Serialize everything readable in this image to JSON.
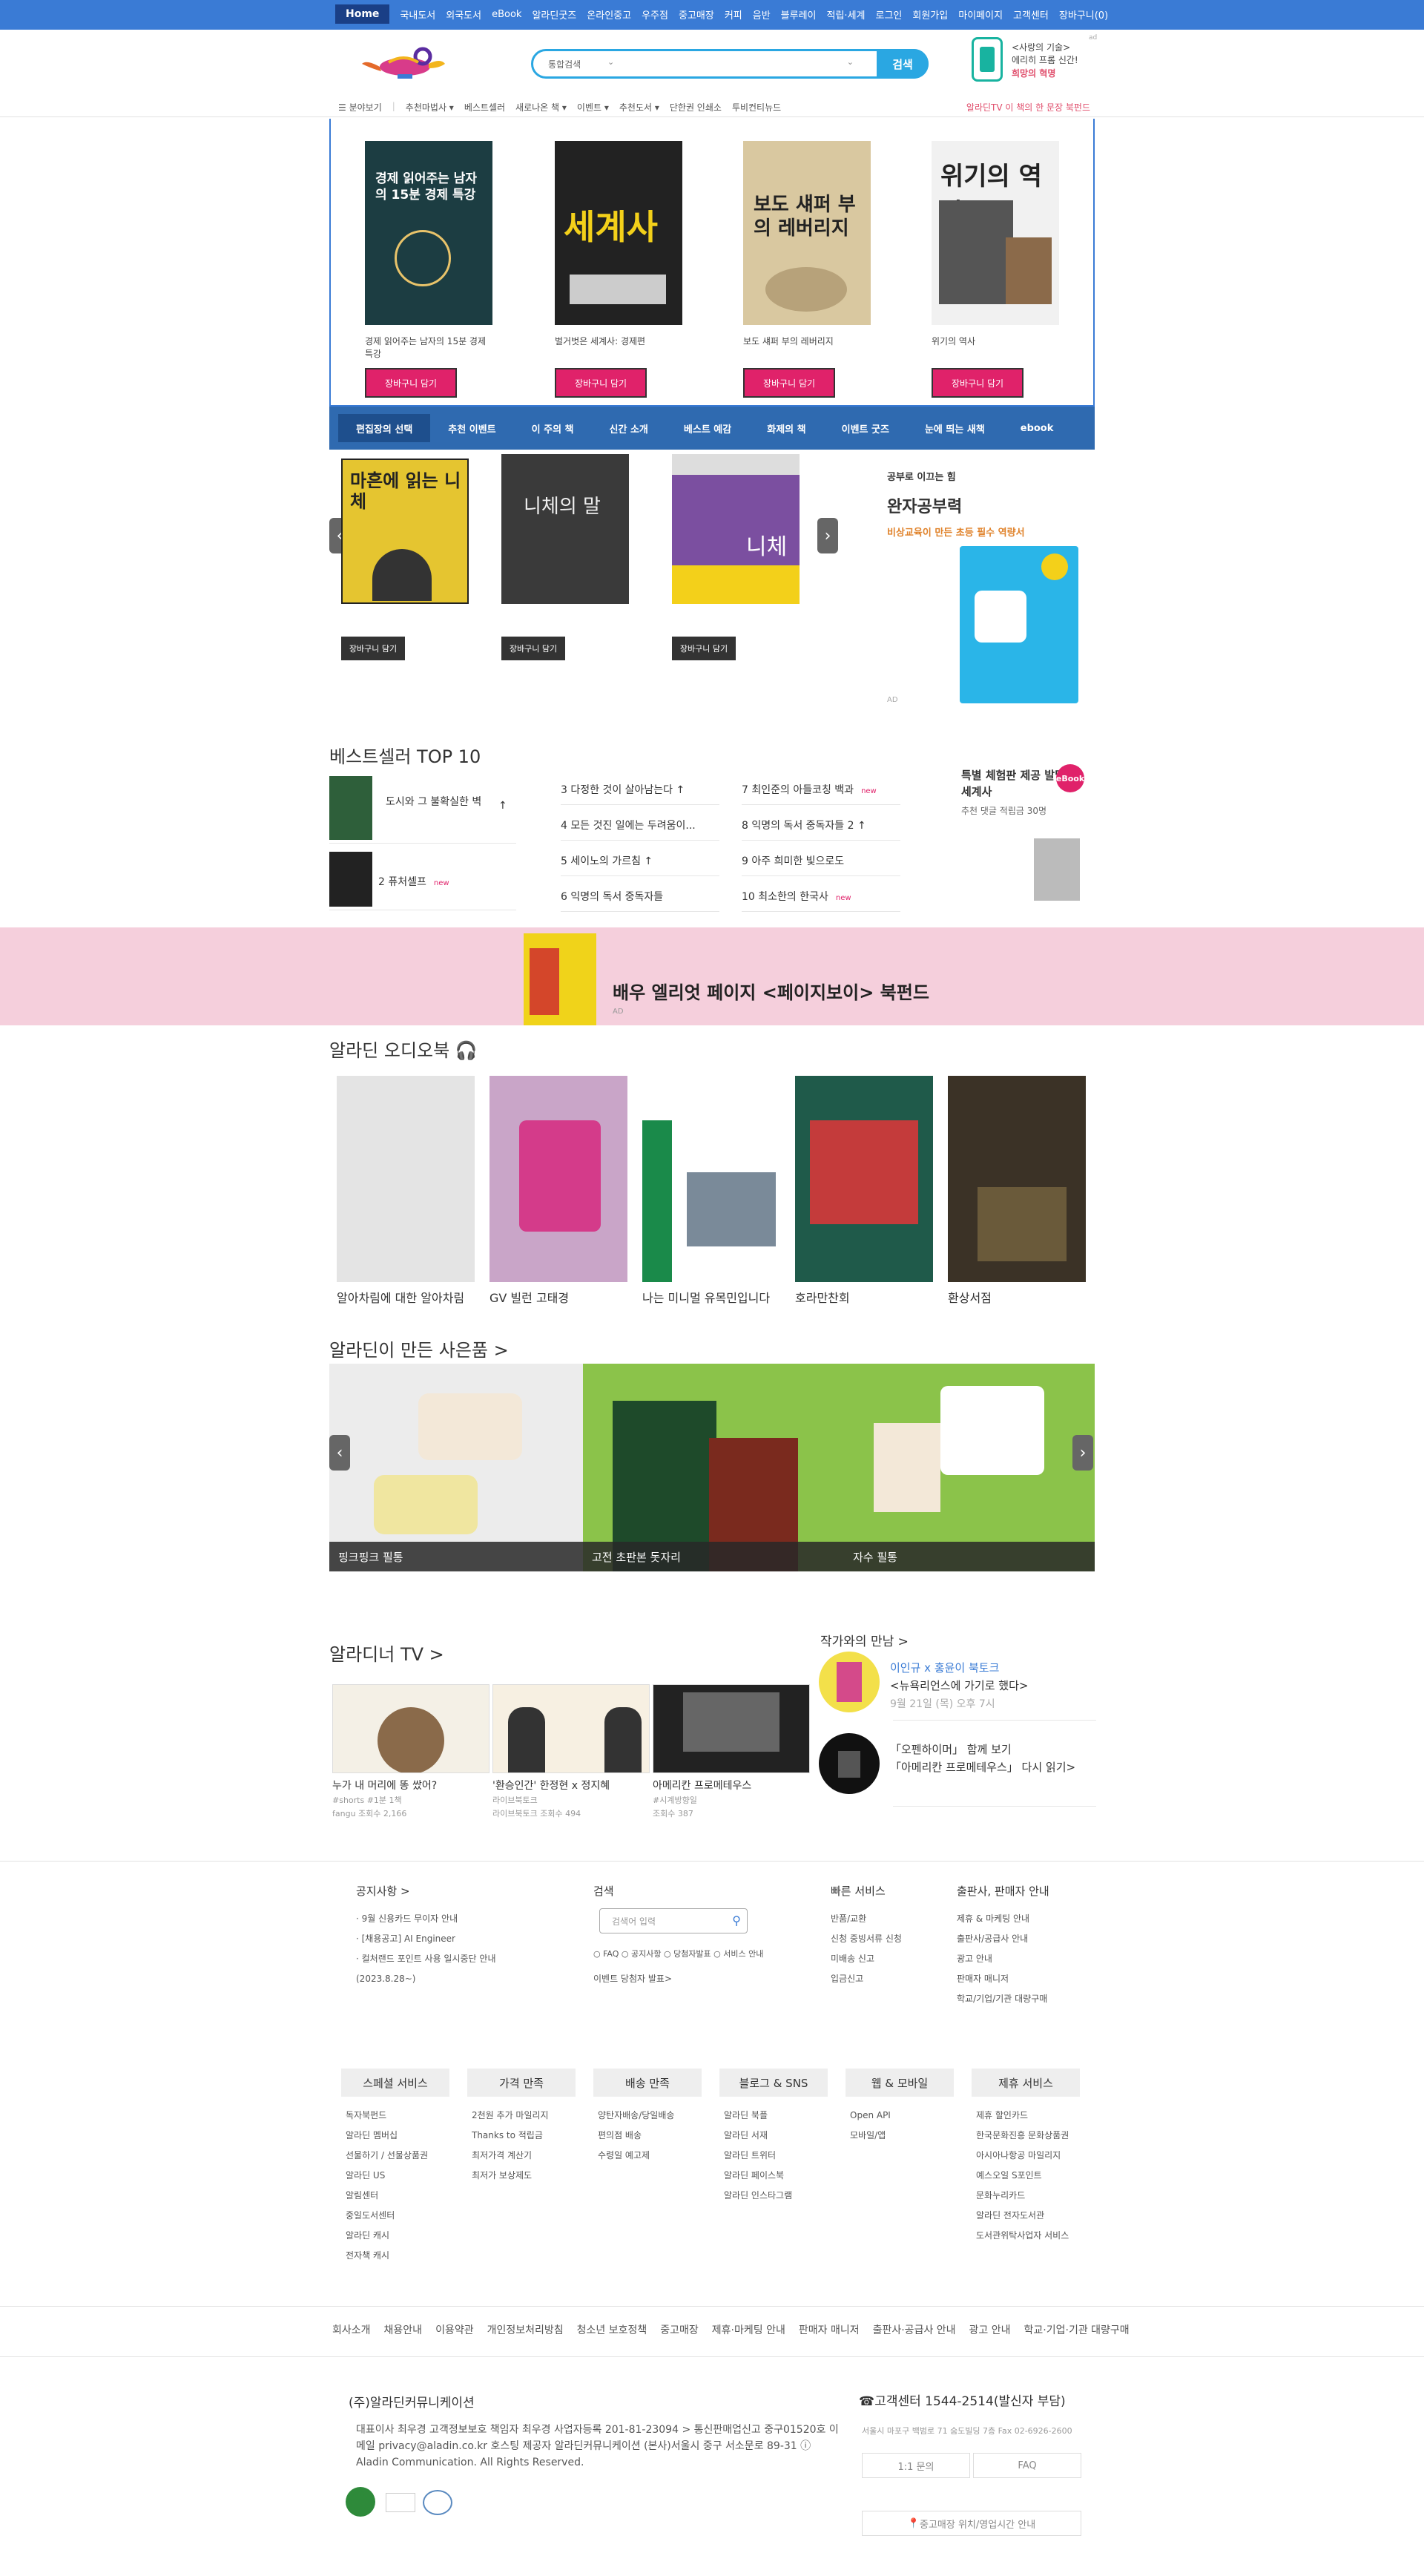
{
  "topnav": {
    "home": "Home",
    "items": [
      "국내도서",
      "외국도서",
      "eBook",
      "알라딘굿즈",
      "온라인중고",
      "우주점",
      "중고매장",
      "커피",
      "음반",
      "블루레이",
      "적립·세계",
      "로그인",
      "회원가입",
      "마이페이지",
      "고객센터",
      "장바구니(0)"
    ]
  },
  "search": {
    "category": "통합검색",
    "button": "검색"
  },
  "header_ad": {
    "line1": "<사랑의 기술>",
    "line2": "에리히 프롬 신간!",
    "line3": "희망의 혁명",
    "ad": "ad"
  },
  "subnav": {
    "items": [
      "분야보기",
      "추천마법사 ▾",
      "베스트셀러",
      "새로나온 책 ▾",
      "이벤트 ▾",
      "추천도서 ▾",
      "단한권 인쇄소",
      "투비컨티뉴드"
    ],
    "right": "알라딘TV 이 책의 한 문장 북펀드"
  },
  "featured": [
    {
      "title": "경제 읽어주는 남자의 15분 경제 특강",
      "cover_text": "경제 읽어주는 남자의 15분 경제 특강",
      "cart": "장바구니 담기"
    },
    {
      "title": "벌거벗은 세계사: 경제편",
      "cover_text": "세계사",
      "cart": "장바구니 담기"
    },
    {
      "title": "보도 섀퍼 부의 레버리지",
      "cover_text": "보도 섀퍼 부의 레버리지",
      "cart": "장바구니 담기"
    },
    {
      "title": "위기의 역사",
      "cover_text": "위기의 역사",
      "cart": "장바구니 담기"
    }
  ],
  "tabs": [
    "편집장의 선택",
    "추천 이벤트",
    "이 주의 책",
    "신간 소개",
    "베스트 예감",
    "화제의 책",
    "이벤트 굿즈",
    "눈에 띄는 새책",
    "ebook"
  ],
  "carousel": [
    {
      "cover_text": "마흔에 읽는 니체",
      "cart": "장바구니 담기"
    },
    {
      "cover_text": "니체의 말",
      "cart": "장바구니 담기"
    },
    {
      "cover_text": "니체",
      "cart": "장바구니 담기"
    }
  ],
  "promo": {
    "small": "공부로 이끄는 힘",
    "big": "완자공부력",
    "sub": "비상교육이 만든 초등 필수 역량서",
    "ad": "AD"
  },
  "bestseller": {
    "title": "베스트셀러 TOP 10",
    "items": [
      {
        "text": "도시와 그 불확실한 벽",
        "arrow": "↑",
        "new": ""
      },
      {
        "text": "2 퓨처셀프",
        "arrow": "",
        "new": "new"
      },
      {
        "text": "3 다정한 것이 살아남는다",
        "arrow": "↑",
        "new": ""
      },
      {
        "text": "4 모든 것진 일에는 두려움이...",
        "arrow": "",
        "new": ""
      },
      {
        "text": "5 세이노의 가르침",
        "arrow": "↑",
        "new": ""
      },
      {
        "text": "6 익명의 독서 중독자들",
        "arrow": "",
        "new": ""
      },
      {
        "text": "7 최인준의 아들코칭 백과",
        "arrow": "",
        "new": "new"
      },
      {
        "text": "8 익명의 독서 중독자들 2",
        "arrow": "↑",
        "new": ""
      },
      {
        "text": "9 아주 희미한 빛으로도",
        "arrow": "",
        "new": ""
      },
      {
        "text": "10 최소한의 한국사",
        "arrow": "",
        "new": "new"
      }
    ],
    "ebook_title": "특별 체험판 제공 발밑의 세계사",
    "ebook_sub": "추천 댓글 적립금 30명",
    "ebook_badge": "eBook"
  },
  "pink_banner": {
    "text": "배우 엘리엇 페이지 <페이지보이> 북펀드",
    "ad": "AD"
  },
  "audiobook": {
    "title": "알라딘 오디오북",
    "items": [
      "알아차림에 대한 알아차림",
      "GV 빌런 고태경",
      "나는 미니멀 유목민입니다",
      "호라만찬회",
      "환상서점"
    ]
  },
  "goods": {
    "title": "알라딘이 만든 사은품 >",
    "items": [
      "핑크핑크 필통",
      "고전 초판본 돗자리",
      "자수 필통"
    ]
  },
  "tv": {
    "title": "알라디너 TV >",
    "items": [
      {
        "title": "누가 내 머리에 똥 쌌어?",
        "meta1": "#shorts #1분 1책",
        "meta2": "fangu 조회수 2,166"
      },
      {
        "title": "'환승인간' 한정현 x 정지혜",
        "meta1": "라이브북토크",
        "meta2": "라이브북토크 조회수 494"
      },
      {
        "title": "아메리칸 프로메테우스",
        "meta1": "#시계방향일",
        "meta2": "조회수 387"
      }
    ]
  },
  "author": {
    "title": "작가와의 만남 >",
    "items": [
      {
        "line1": "이인규 x 홍윤이 북토크",
        "line2": "<뉴욕리언스에 가기로 했다>",
        "date": "9월 21일 (목) 오후 7시"
      },
      {
        "line1": "「오펜하이머」 함께 보기",
        "line2": "「아메리칸 프로메테우스」 다시 읽기>",
        "date": ""
      }
    ]
  },
  "footer": {
    "notice_title": "공지사항 >",
    "notices": [
      "· 9월 신용카드 무이자 안내",
      "· [채용공고] AI Engineer",
      "· 컬처랜드 포인트 사용 일시중단 안내(2023.8.28~)"
    ],
    "search_title": "검색",
    "search_placeholder": "검색어 입력",
    "search_options": "○ FAQ ○ 공지사항 ○ 당첨자발표 ○ 서비스 안내",
    "event_winner": "이벤트 당첨자 발표>",
    "quick_title": "빠른 서비스",
    "quick": [
      "반품/교환",
      "신청 중빙서류 신청",
      "미배송 신고",
      "입금신고"
    ],
    "pub_title": "출판사, 판매자 안내",
    "pub": [
      "제휴 & 마케팅 안내",
      "출판사/공급사 안내",
      "광고 안내",
      "판매자 매니저",
      "학교/기업/기관 대량구매"
    ],
    "services": [
      {
        "head": "스페셜 서비스",
        "items": [
          "독자북펀드",
          "알라딘 멤버십",
          "선물하기 / 선물상품권",
          "알라딘 US",
          "알림센터",
          "중일도서센터",
          "알라딘 캐시",
          "전자책 캐시"
        ]
      },
      {
        "head": "가격 만족",
        "items": [
          "2천원 추가 마일리지",
          "Thanks to 적립금",
          "최저가격 계산기",
          "최저가 보상제도"
        ]
      },
      {
        "head": "배송 만족",
        "items": [
          "양탄자배송/당일배송",
          "편의점 배송",
          "수령일 예고제"
        ]
      },
      {
        "head": "블로그 & SNS",
        "items": [
          "알라딘 북플",
          "알라딘 서재",
          "알라딘 트위터",
          "알라딘 페이스북",
          "알라딘 인스타그램"
        ]
      },
      {
        "head": "웹 & 모바일",
        "items": [
          "Open API",
          "모바일/앱"
        ]
      },
      {
        "head": "제휴 서비스",
        "items": [
          "제휴 할인카드",
          "한국문화진흥 문화상품권",
          "아시아나항공 마일리지",
          "예스오일 S포인트",
          "문화누리카드",
          "알라딘 전자도서관",
          "도서관위탁사업자 서비스"
        ]
      }
    ],
    "bottom_links": [
      "회사소개",
      "채용안내",
      "이용약관",
      "개인정보처리방침",
      "청소년 보호정책",
      "중고매장",
      "제휴·마케팅 안내",
      "판매자 매니저",
      "출판사·공급사 안내",
      "광고 안내",
      "학교·기업·기관 대량구매"
    ],
    "company": "(주)알라딘커뮤니케이션",
    "company_info": "대표이사 최우경 고객정보보호 책임자 최우경 사업자등록 201-81-23094 > 통신판매업신고 중구01520호 이메일 privacy@aladin.co.kr 호스팅 제공자 알라딘커뮤니케이션 (본사)서울시 중구 서소문로 89-31 ⓘ Aladin Communication. All Rights Reserved.",
    "cs": "고객센터 1544-2514(발신자 부담)",
    "cs_small": "서울시 마포구 백범로 71 숨도빌딩 7층 Fax 02-6926-2600",
    "cs_btn1": "1:1 문의",
    "cs_btn2": "FAQ",
    "cs_btn3": "중고매장 위치/영업시간 안내"
  },
  "colors": {
    "accent": "#3a7bd5",
    "pink": "#e0226a",
    "search": "#2aa7e2",
    "tabs": "#2f6ab0"
  }
}
